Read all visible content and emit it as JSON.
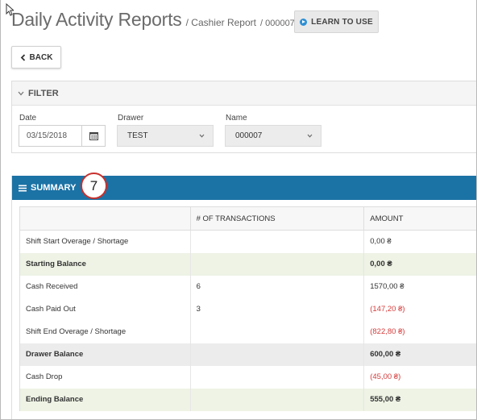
{
  "header": {
    "title": "Daily Activity Reports",
    "crumb": "/ Cashier Report",
    "crumb_id": "/ 000007",
    "learn_label": "LEARN TO USE",
    "back_label": "BACK"
  },
  "filter": {
    "title": "FILTER",
    "date_label": "Date",
    "date_value": "03/15/2018",
    "drawer_label": "Drawer",
    "drawer_value": "TEST",
    "name_label": "Name",
    "name_value": "000007"
  },
  "summary": {
    "title": "SUMMARY",
    "callout": "7",
    "columns": [
      "",
      "# OF TRANSACTIONS",
      "AMOUNT"
    ],
    "rows": [
      {
        "label": "Shift Start Overage / Shortage",
        "count": "",
        "amount": "0,00 ₴",
        "style": "",
        "negative": false
      },
      {
        "label": "Starting Balance",
        "count": "",
        "amount": "0,00 ₴",
        "style": "bold green",
        "negative": false
      },
      {
        "label": "Cash Received",
        "count": "6",
        "amount": "1570,00 ₴",
        "style": "",
        "negative": false
      },
      {
        "label": "Cash Paid Out",
        "count": "3",
        "amount": "(147,20 ₴)",
        "style": "",
        "negative": true
      },
      {
        "label": "Shift End Overage / Shortage",
        "count": "",
        "amount": "(822,80 ₴)",
        "style": "",
        "negative": true
      },
      {
        "label": "Drawer Balance",
        "count": "",
        "amount": "600,00 ₴",
        "style": "bold gray",
        "negative": false
      },
      {
        "label": "Cash Drop",
        "count": "",
        "amount": "(45,00 ₴)",
        "style": "",
        "negative": true
      },
      {
        "label": "Ending Balance",
        "count": "",
        "amount": "555,00 ₴",
        "style": "bold green",
        "negative": false
      }
    ],
    "negative_color": "#d63b3b",
    "header_color": "#1b72a5"
  }
}
